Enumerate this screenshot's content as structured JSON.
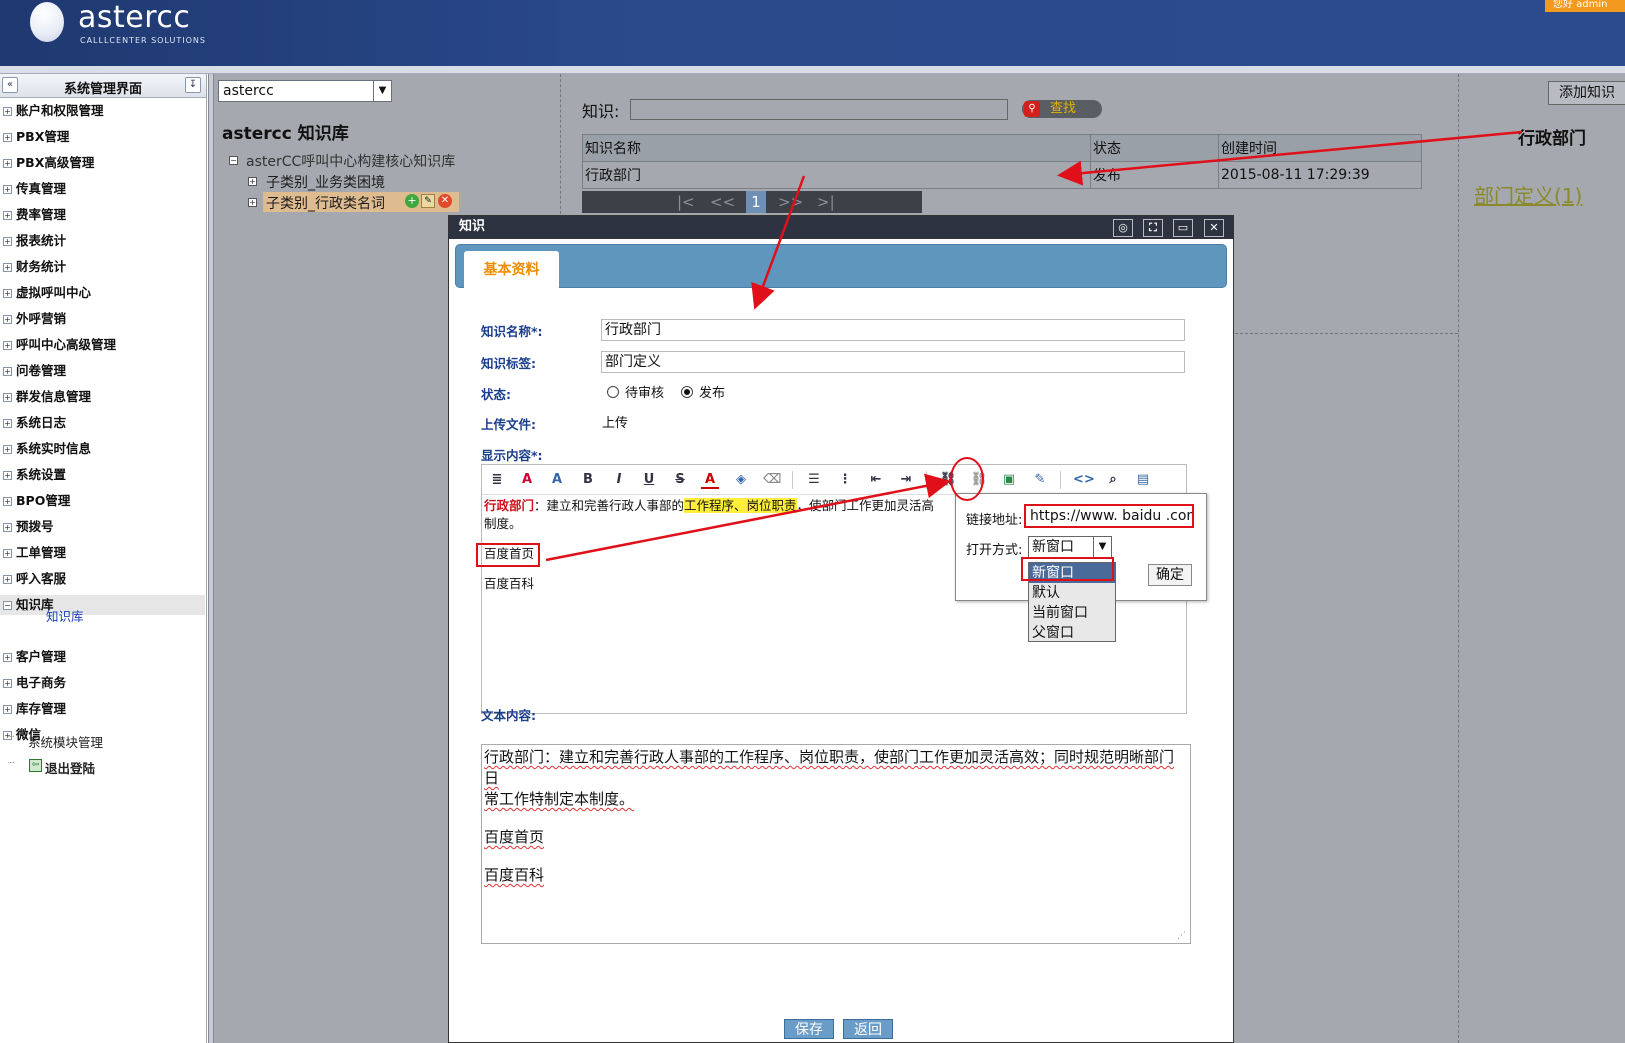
{
  "header": {
    "logo_text": "astercc",
    "logo_sub": "CALLLCENTER SOLUTIONS",
    "user_badge": "您好 admin"
  },
  "sidebar": {
    "title": "系统管理界面",
    "collapse_glyph": "«",
    "pin_glyph": "↧",
    "items": [
      {
        "label": "账户和权限管理",
        "expanded": false
      },
      {
        "label": "PBX管理",
        "expanded": false
      },
      {
        "label": "PBX高级管理",
        "expanded": false
      },
      {
        "label": "传真管理",
        "expanded": false
      },
      {
        "label": "费率管理",
        "expanded": false
      },
      {
        "label": "报表统计",
        "expanded": false
      },
      {
        "label": "财务统计",
        "expanded": false
      },
      {
        "label": "虚拟呼叫中心",
        "expanded": false
      },
      {
        "label": "外呼营销",
        "expanded": false
      },
      {
        "label": "呼叫中心高级管理",
        "expanded": false
      },
      {
        "label": "问卷管理",
        "expanded": false
      },
      {
        "label": "群发信息管理",
        "expanded": false
      },
      {
        "label": "系统日志",
        "expanded": false
      },
      {
        "label": "系统实时信息",
        "expanded": false
      },
      {
        "label": "系统设置",
        "expanded": false
      },
      {
        "label": "BPO管理",
        "expanded": false
      },
      {
        "label": "预拨号",
        "expanded": false
      },
      {
        "label": "工单管理",
        "expanded": false
      },
      {
        "label": "呼入客服",
        "expanded": false
      },
      {
        "label": "知识库",
        "expanded": true
      },
      {
        "label": "客户管理",
        "expanded": false
      },
      {
        "label": "电子商务",
        "expanded": false
      },
      {
        "label": "库存管理",
        "expanded": false
      },
      {
        "label": "微信",
        "expanded": false
      }
    ],
    "sub_knowledge": "知识库",
    "module_mgmt": "系统模块管理",
    "logout": "退出登陆"
  },
  "kb_panel": {
    "select_value": "astercc",
    "title": "astercc 知识库",
    "tree_root": "asterCC呼叫中心构建核心知识库",
    "tree_child1": "子类别_业务类困境",
    "tree_child2": "子类别_行政类名词"
  },
  "search": {
    "label": "知识:",
    "value": "",
    "button": "查找"
  },
  "results": {
    "headers": [
      "知识名称",
      "状态",
      "创建时间"
    ],
    "rows": [
      [
        "行政部门",
        "发布",
        "2015-08-11 17:29:39"
      ]
    ],
    "pager": {
      "first": "|<",
      "prev": "<<",
      "page": "1",
      "next": ">>",
      "last": ">|"
    }
  },
  "right_panel": {
    "add_button": "添加知识",
    "dept_title": "行政部门",
    "dept_link": "部门定义(1)"
  },
  "dialog": {
    "title": "知识",
    "tab": "基本资料",
    "name_label": "知识名称*:",
    "name_value": "行政部门",
    "tag_label": "知识标签:",
    "tag_value": "部门定义",
    "status_label": "状态:",
    "status_options": [
      "待审核",
      "发布"
    ],
    "status_selected": "发布",
    "upload_label": "上传文件:",
    "upload_link": "上传",
    "display_label": "显示内容*:",
    "editor": {
      "line1_head": "行政部门",
      "line1_sep": "：建立和完善行政人事部的",
      "line1_hl": "工作程序、岗位职责",
      "line1_tail": "，使部门工作更加灵活高",
      "line2": "制度。",
      "link1": "百度首页",
      "link2": "百度百科"
    },
    "text_label": "文本内容:",
    "text_content": {
      "line1": "行政部门：建立和完善行政人事部的工作程序、岗位职责，使部门工作更加灵活高效；同时规范明晰部门日",
      "line2": "常工作特制定本制度。",
      "line3": "百度首页",
      "line4": "百度百科"
    },
    "save": "保存",
    "back": "返回"
  },
  "link_popup": {
    "url_label": "链接地址:",
    "url_value": "https://www. baidu .com",
    "open_label": "打开方式:",
    "open_value": "新窗口",
    "ok": "确定",
    "options": [
      "新窗口",
      "默认",
      "当前窗口",
      "父窗口"
    ]
  },
  "colors": {
    "header": "#2a4a8c",
    "accent_orange": "#f08c00",
    "annotation_red": "#e0101a",
    "dialog_tab_bar": "#5f96be"
  }
}
